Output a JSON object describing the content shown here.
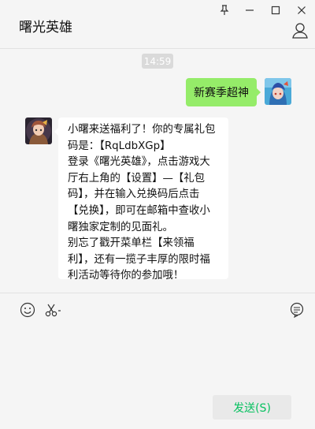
{
  "window": {
    "title": "曙光英雄",
    "controls": [
      "pin-icon",
      "minimize-icon",
      "maximize-icon",
      "close-icon"
    ]
  },
  "chat": {
    "timestamp": "14:59",
    "messages": [
      {
        "sender": "me",
        "text": "新赛季超神"
      },
      {
        "sender": "bot",
        "lines": [
          "小曙来送福利了！你的专属礼包",
          "码是：【RqLdbXGp】",
          "登录《曙光英雄》，点击游戏大",
          "厅右上角的【设置】—【礼包",
          "码】，并在输入兑换码后点击",
          "【兑换】，即可在邮箱中查收小",
          "曙独家定制的见面礼。",
          "别忘了戳开菜单栏【来领福",
          "利】，还有一揽子丰厚的限时福",
          "利活动等待你的参加哦！"
        ]
      }
    ]
  },
  "input": {
    "tools": [
      "emoji-icon",
      "scissors-icon",
      "chat-history-icon"
    ],
    "send_label": "发送(S)"
  },
  "colors": {
    "my_bubble": "#95ec69",
    "send_text": "#07c160",
    "background": "#f5f5f5"
  }
}
